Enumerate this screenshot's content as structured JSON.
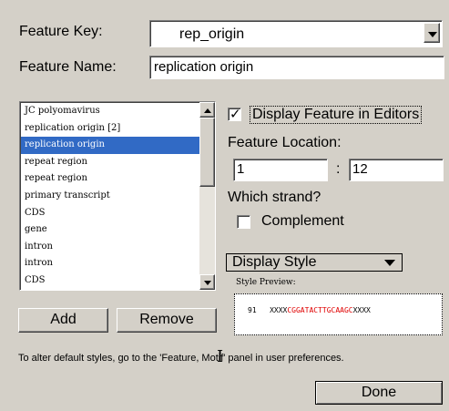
{
  "feature_key": {
    "label": "Feature Key:",
    "value": "rep_origin"
  },
  "feature_name": {
    "label": "Feature Name:",
    "value": "replication origin"
  },
  "feature_list": {
    "items": [
      "JC polyomavirus",
      "replication origin [2]",
      "replication origin",
      "repeat region",
      "repeat region",
      "primary transcript",
      "CDS",
      "gene",
      "intron",
      "intron",
      "CDS"
    ],
    "selected_index": 2
  },
  "display_in_editors": {
    "label": "Display Feature in Editors",
    "checked": true
  },
  "location": {
    "label": "Feature Location:",
    "start": "1",
    "separator": ":",
    "end": "12"
  },
  "strand": {
    "label": "Which strand?",
    "complement_label": "Complement",
    "complement_checked": false
  },
  "display_style": {
    "value": "Display Style"
  },
  "style_preview": {
    "label": "Style Preview:",
    "position": "91",
    "seq_before": "XXXX",
    "seq_highlight": "CGGATACTTGCAAGC",
    "seq_after": "XXXX",
    "highlight_color": "#e00000"
  },
  "buttons": {
    "add": "Add",
    "remove": "Remove",
    "done": "Done"
  },
  "hint": "To alter default styles, go to the 'Feature, Motif' panel in user preferences."
}
